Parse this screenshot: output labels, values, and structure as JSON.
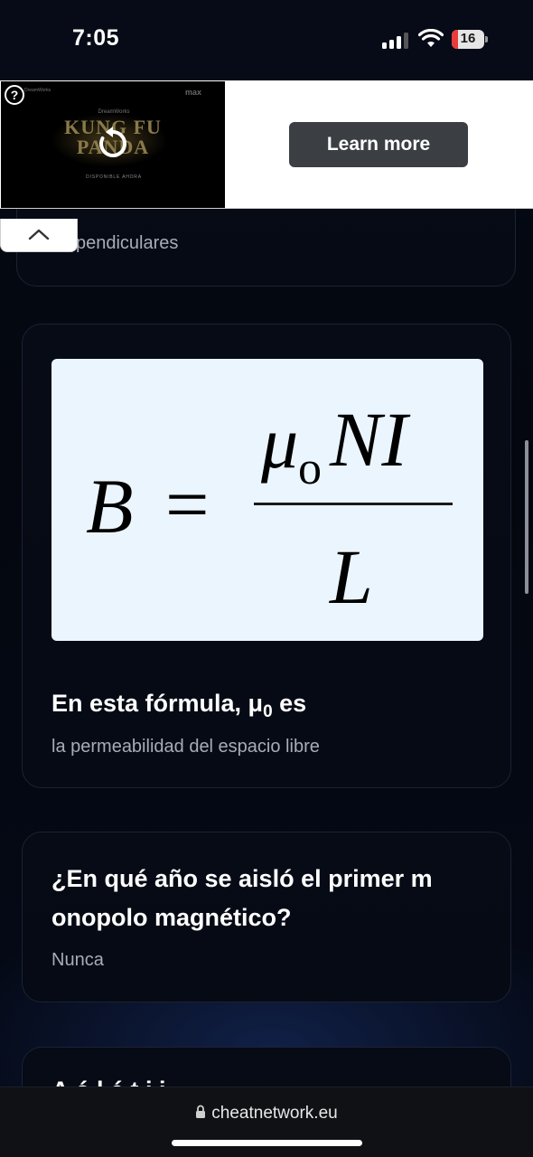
{
  "status_bar": {
    "time": "7:05",
    "battery_level": "16",
    "battery_color": "#ea3b3b"
  },
  "ad": {
    "movie_title_line1": "KUNG FU",
    "movie_title_line2": "PANDA",
    "studio": "DreamWorks",
    "corner_small_text": "max",
    "availability": "DISPONIBLE AHORA",
    "cta_label": "Learn more",
    "help_icon": "question-mark-icon",
    "replay_icon": "replay-icon",
    "collapse_icon": "chevron-up-icon"
  },
  "cards": {
    "previous_answer": "pendiculares",
    "formula": {
      "lhs": "B",
      "equals": "=",
      "numerator": "μ",
      "subscript": "o",
      "numerator_rest": "NI",
      "denominator": "L"
    },
    "formula_question": "En esta fórmula, μ",
    "formula_question_sub": "0",
    "formula_question_end": " es",
    "formula_answer": "la permeabilidad del espacio libre",
    "monopolo_question_line1": "¿En qué año se aisló el primer m",
    "monopolo_question_line2": "onopolo magnético?",
    "monopolo_answer": "Nunca",
    "next_question_partial": "A ó                               l  é t i           i"
  },
  "browser": {
    "url": "cheatnetwork.eu",
    "lock_icon": "lock-icon"
  },
  "colors": {
    "background": "#03060f",
    "card_border": "#1b2233",
    "answer_text": "#a7acb6",
    "formula_bg": "#ebf5fd",
    "cta_bg": "#3b3e43"
  }
}
